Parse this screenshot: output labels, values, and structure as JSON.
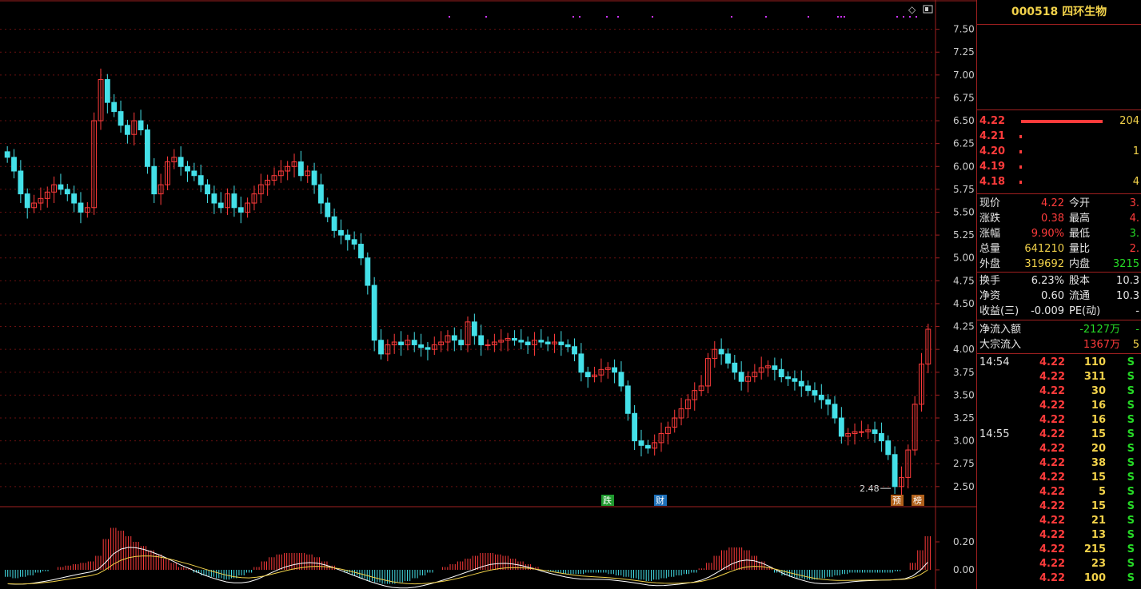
{
  "stock": {
    "code": "000518",
    "name": "四环生物"
  },
  "price_axis": [
    "7.50",
    "7.25",
    "7.00",
    "6.75",
    "6.50",
    "6.25",
    "6.00",
    "5.75",
    "5.50",
    "5.25",
    "5.00",
    "4.75",
    "4.50",
    "4.25",
    "4.00",
    "3.75",
    "3.50",
    "3.25",
    "3.00",
    "2.75",
    "2.50"
  ],
  "macd_axis": [
    "0.20",
    "0.00"
  ],
  "low_label": "2.48",
  "markers": [
    {
      "text": "跌",
      "color": "#1f9a2e"
    },
    {
      "text": "财",
      "color": "#1d6fb8"
    },
    {
      "text": "预",
      "color": "#b0601a"
    },
    {
      "text": "榜",
      "color": "#b0601a"
    }
  ],
  "orderbook": [
    {
      "price": "4.22",
      "vol": "204"
    },
    {
      "price": "4.21",
      "vol": ""
    },
    {
      "price": "4.20",
      "vol": "1"
    },
    {
      "price": "4.19",
      "vol": ""
    },
    {
      "price": "4.18",
      "vol": "4"
    }
  ],
  "quote": [
    {
      "l1": "现价",
      "v1": "4.22",
      "l2": "今开",
      "v2": "3."
    },
    {
      "l1": "涨跌",
      "v1": "0.38",
      "l2": "最高",
      "v2": "4."
    },
    {
      "l1": "涨幅",
      "v1": "9.90%",
      "l2": "最低",
      "v2": "3."
    },
    {
      "l1": "总量",
      "v1": "641210",
      "l2": "量比",
      "v2": "2."
    },
    {
      "l1": "外盘",
      "v1": "319692",
      "l2": "内盘",
      "v2": "3215"
    }
  ],
  "fundamentals": [
    {
      "l1": "换手",
      "v1": "6.23%",
      "l2": "股本",
      "v2": "10.3"
    },
    {
      "l1": "净资",
      "v1": "0.60",
      "l2": "流通",
      "v2": "10.3"
    },
    {
      "l1": "收益(三)",
      "v1": "-0.009",
      "l2": "PE(动)",
      "v2": "-"
    }
  ],
  "flows": [
    {
      "label": "净流入额",
      "value": "-2127万",
      "extra": "-"
    },
    {
      "label": "大宗流入",
      "value": "1367万",
      "extra": "5"
    }
  ],
  "ticks": [
    {
      "time": "14:54",
      "price": "4.22",
      "vol": "110",
      "side": "S"
    },
    {
      "time": "",
      "price": "4.22",
      "vol": "311",
      "side": "S"
    },
    {
      "time": "",
      "price": "4.22",
      "vol": "30",
      "side": "S"
    },
    {
      "time": "",
      "price": "4.22",
      "vol": "16",
      "side": "S"
    },
    {
      "time": "",
      "price": "4.22",
      "vol": "16",
      "side": "S"
    },
    {
      "time": "14:55",
      "price": "4.22",
      "vol": "15",
      "side": "S"
    },
    {
      "time": "",
      "price": "4.22",
      "vol": "20",
      "side": "S"
    },
    {
      "time": "",
      "price": "4.22",
      "vol": "38",
      "side": "S"
    },
    {
      "time": "",
      "price": "4.22",
      "vol": "15",
      "side": "S"
    },
    {
      "time": "",
      "price": "4.22",
      "vol": "5",
      "side": "S"
    },
    {
      "time": "",
      "price": "4.22",
      "vol": "15",
      "side": "S"
    },
    {
      "time": "",
      "price": "4.22",
      "vol": "21",
      "side": "S"
    },
    {
      "time": "",
      "price": "4.22",
      "vol": "13",
      "side": "S"
    },
    {
      "time": "",
      "price": "4.22",
      "vol": "215",
      "side": "S"
    },
    {
      "time": "",
      "price": "4.22",
      "vol": "23",
      "side": "S"
    },
    {
      "time": "",
      "price": "4.22",
      "vol": "100",
      "side": "S"
    }
  ],
  "chart_data": {
    "type": "candlestick",
    "ylim": [
      2.35,
      7.75
    ],
    "closes": [
      6.1,
      5.95,
      5.7,
      5.55,
      5.6,
      5.65,
      5.72,
      5.8,
      5.75,
      5.7,
      5.6,
      5.5,
      5.55,
      6.5,
      6.95,
      6.7,
      6.6,
      6.45,
      6.35,
      6.5,
      6.4,
      6.0,
      5.7,
      5.8,
      6.05,
      6.1,
      6.0,
      5.95,
      5.9,
      5.8,
      5.7,
      5.6,
      5.55,
      5.7,
      5.55,
      5.5,
      5.6,
      5.7,
      5.8,
      5.85,
      5.9,
      5.95,
      6.0,
      6.05,
      5.9,
      5.95,
      5.8,
      5.6,
      5.45,
      5.3,
      5.25,
      5.2,
      5.15,
      5.0,
      4.7,
      4.1,
      3.95,
      4.05,
      4.08,
      4.05,
      4.1,
      4.05,
      4.02,
      4.0,
      4.05,
      4.08,
      4.15,
      4.1,
      4.05,
      4.3,
      4.15,
      4.05,
      4.05,
      4.08,
      4.1,
      4.12,
      4.1,
      4.08,
      4.05,
      4.1,
      4.08,
      4.06,
      4.08,
      4.05,
      4.03,
      3.95,
      3.75,
      3.7,
      3.72,
      3.78,
      3.8,
      3.75,
      3.6,
      3.3,
      3.0,
      2.95,
      2.92,
      2.98,
      3.08,
      3.15,
      3.25,
      3.35,
      3.45,
      3.55,
      3.6,
      3.9,
      4.0,
      3.95,
      3.85,
      3.75,
      3.65,
      3.7,
      3.75,
      3.8,
      3.82,
      3.78,
      3.7,
      3.68,
      3.65,
      3.6,
      3.55,
      3.5,
      3.45,
      3.4,
      3.25,
      3.05,
      3.08,
      3.1,
      3.1,
      3.12,
      3.08,
      3.0,
      2.85,
      2.5,
      2.6,
      2.9,
      3.4,
      3.84,
      4.22
    ],
    "macd": [
      -0.05,
      -0.06,
      -0.05,
      -0.04,
      -0.02,
      -0.01,
      0.0,
      0.02,
      0.03,
      0.04,
      0.05,
      0.06,
      0.1,
      0.22,
      0.3,
      0.28,
      0.24,
      0.2,
      0.17,
      0.14,
      0.11,
      0.08,
      0.05,
      0.02,
      0.01,
      -0.02,
      -0.04,
      -0.05,
      -0.06,
      -0.07,
      -0.06,
      -0.04,
      -0.02,
      0.02,
      0.06,
      0.09,
      0.11,
      0.12,
      0.12,
      0.12,
      0.11,
      0.09,
      0.06,
      0.03,
      0.0,
      -0.02,
      -0.04,
      -0.06,
      -0.08,
      -0.09,
      -0.1,
      -0.1,
      -0.09,
      -0.08,
      -0.06,
      -0.04,
      -0.02,
      0.0,
      0.02,
      0.04,
      0.06,
      0.08,
      0.1,
      0.12,
      0.12,
      0.11,
      0.1,
      0.08,
      0.06,
      0.04,
      0.02,
      0.0,
      -0.01,
      -0.02,
      -0.03,
      -0.03,
      -0.03,
      -0.02,
      -0.02,
      -0.02,
      -0.03,
      -0.04,
      -0.05,
      -0.06,
      -0.07,
      -0.08,
      -0.07,
      -0.06,
      -0.05,
      -0.04,
      -0.03,
      -0.02,
      0.01,
      0.05,
      0.1,
      0.14,
      0.16,
      0.16,
      0.14,
      0.1,
      0.06,
      0.02,
      -0.02,
      -0.04,
      -0.05,
      -0.06,
      -0.07,
      -0.07,
      -0.06,
      -0.05,
      -0.04,
      -0.03,
      -0.02,
      -0.02,
      -0.02,
      -0.02,
      -0.02,
      -0.02,
      -0.01,
      0.0,
      0.05,
      0.14,
      0.24
    ]
  }
}
